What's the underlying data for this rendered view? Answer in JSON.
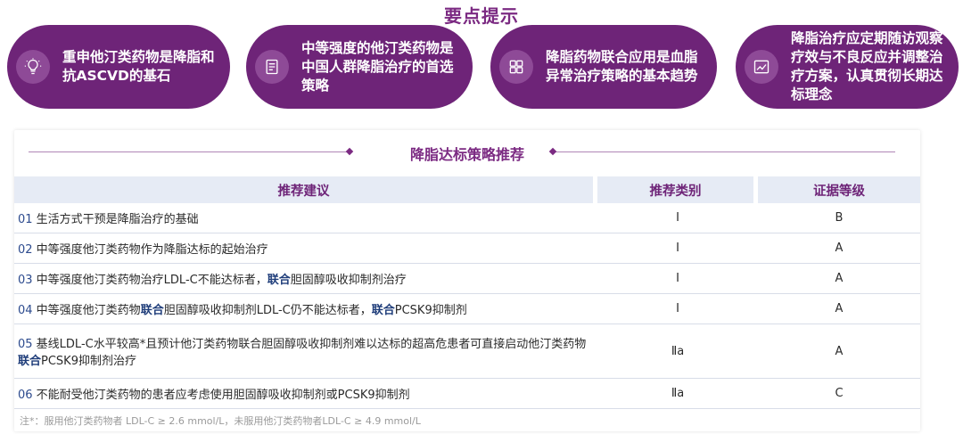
{
  "page_title": "要点提示",
  "cards": [
    {
      "icon": "lightbulb-icon",
      "text": "重申他汀类药物是降脂和抗ASCVD的基石"
    },
    {
      "icon": "document-list-icon",
      "text": "中等强度的他汀类药物是中国人群降脂治疗的首选策略"
    },
    {
      "icon": "grid-icon",
      "text": "降脂药物联合应用是血脂异常治疗策略的基本趋势"
    },
    {
      "icon": "trend-chart-icon",
      "text": "降脂治疗应定期随访观察疗效与不良反应并调整治疗方案，认真贯彻长期达标理念"
    }
  ],
  "section_title": "降脂达标策略推荐",
  "table": {
    "headers": [
      "推荐建议",
      "推荐类别",
      "证据等级"
    ],
    "rows": [
      {
        "num": "01",
        "parts": [
          {
            "t": " 生活方式干预是降脂治疗的基础",
            "hl": false
          }
        ],
        "class": "I",
        "level": "B"
      },
      {
        "num": "02",
        "parts": [
          {
            "t": " 中等强度他汀类药物作为降脂达标的起始治疗",
            "hl": false
          }
        ],
        "class": "I",
        "level": "A"
      },
      {
        "num": "03",
        "parts": [
          {
            "t": " 中等强度他汀类药物治疗LDL-C不能达标者，",
            "hl": false
          },
          {
            "t": "联合",
            "hl": true
          },
          {
            "t": "胆固醇吸收抑制剂治疗",
            "hl": false
          }
        ],
        "class": "I",
        "level": "A"
      },
      {
        "num": "04",
        "parts": [
          {
            "t": " 中等强度他汀类药物",
            "hl": false
          },
          {
            "t": "联合",
            "hl": true
          },
          {
            "t": "胆固醇吸收抑制剂LDL-C仍不能达标者，",
            "hl": false
          },
          {
            "t": "联合",
            "hl": true
          },
          {
            "t": "PCSK9抑制剂",
            "hl": false
          }
        ],
        "class": "I",
        "level": "A"
      },
      {
        "num": "05",
        "parts": [
          {
            "t": "  基线LDL-C水平较高*且预计他汀类药物联合胆固醇吸收抑制剂难以达标的超高危患者可直接启动他汀类药物",
            "hl": false
          },
          {
            "t": "联合",
            "hl": true
          },
          {
            "t": "PCSK9抑制剂治疗",
            "hl": false
          }
        ],
        "class": "Ⅱa",
        "level": "A"
      },
      {
        "num": "06",
        "parts": [
          {
            "t": " 不能耐受他汀类药物的患者应考虑使用胆固醇吸收抑制剂或PCSK9抑制剂",
            "hl": false
          }
        ],
        "class": "Ⅱa",
        "level": "C"
      }
    ]
  },
  "footnote": "注*：服用他汀类药物者 LDL-C ≥ 2.6 mmol/L，未服用他汀类药物者LDL-C ≥ 4.9 mmol/L",
  "colors": {
    "primary": "#6e2478",
    "header_bg": "#e6ebf5",
    "highlight": "#1f3d7a"
  }
}
